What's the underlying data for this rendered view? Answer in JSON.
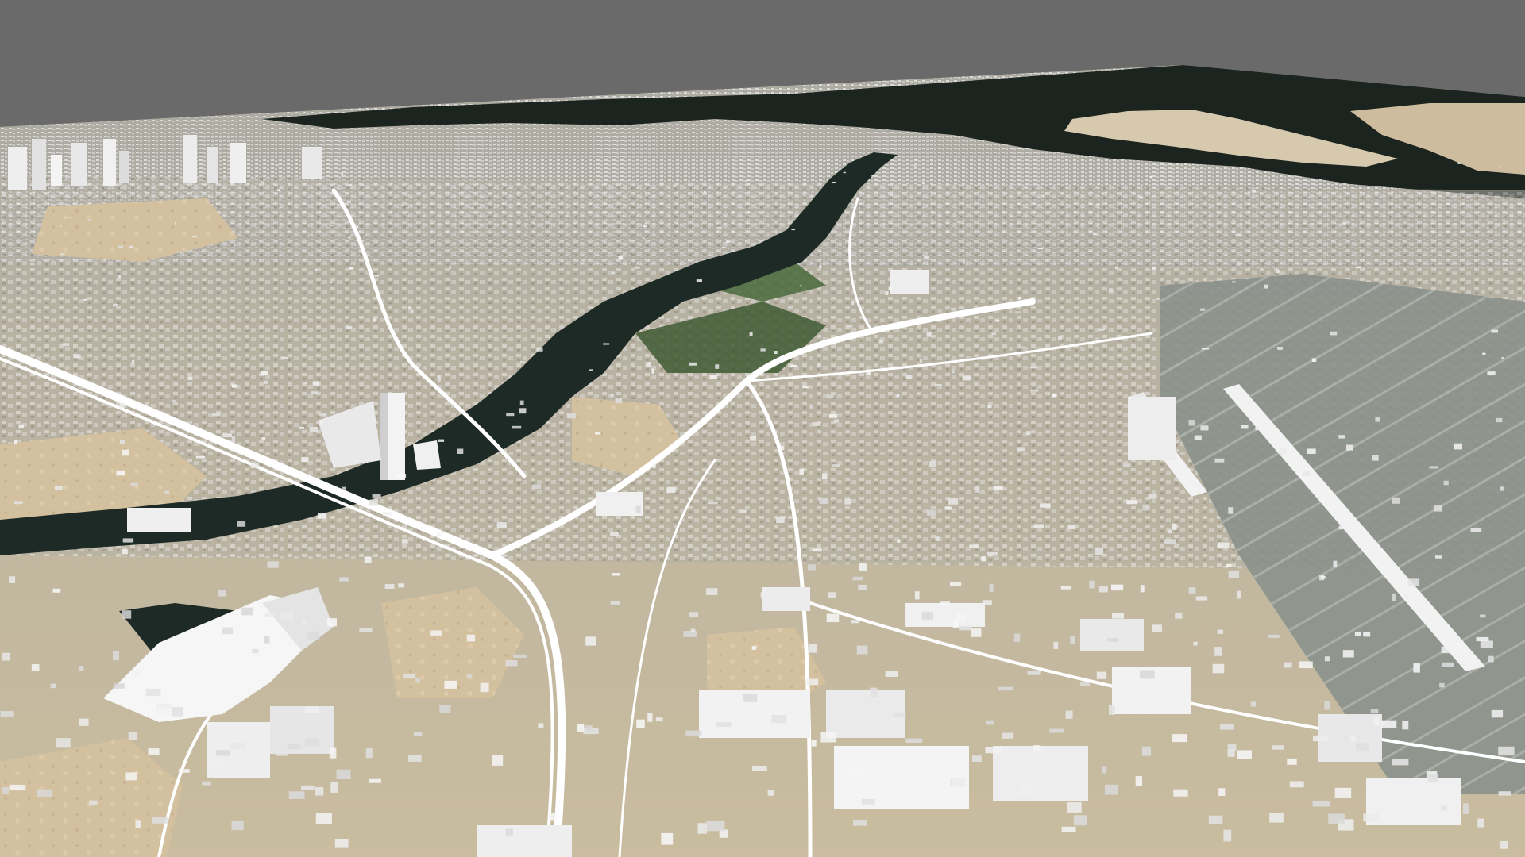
{
  "scene": {
    "view": "3d-perspective-city-map",
    "background_color": "#6a6a6a",
    "colors": {
      "sky": "#6a6a6a",
      "sea": "#1b2420",
      "creek": "#1d2a25",
      "desert": "#d2bf9e",
      "sand_light": "#e4d8c0",
      "urban": "#b9b4a8",
      "vegetation": "#3f5a34",
      "building": "#f1f1f1",
      "building_shade": "#c9c9cb",
      "road": "#ffffff",
      "airport": "#8e9590"
    },
    "landmarks": [
      {
        "name": "creek",
        "icon": "water-channel"
      },
      {
        "name": "airport-runways",
        "icon": "runway"
      },
      {
        "name": "highway-interchange",
        "icon": "road-interchange"
      },
      {
        "name": "high-rise-cluster",
        "icon": "skyscraper"
      },
      {
        "name": "coastline",
        "icon": "shoreline"
      }
    ]
  }
}
